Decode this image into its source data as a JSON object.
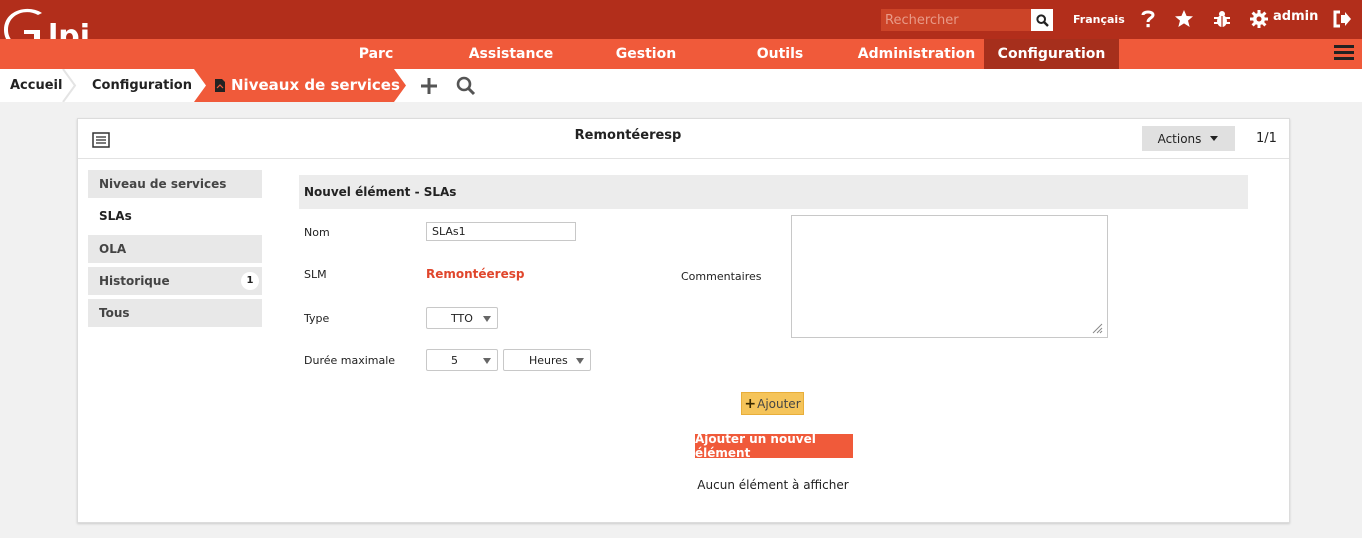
{
  "colors": {
    "topbar": "#b22e1b",
    "menubar": "#f05a3a",
    "menu_active": "#a62f1c",
    "accent": "#f05a3a",
    "ajouter_button": "#f5c45a"
  },
  "header": {
    "logo_text": "Glpi",
    "search_placeholder": "Rechercher",
    "language": "Français",
    "user": "admin",
    "icons": [
      "help-icon",
      "star-icon",
      "bug-icon",
      "gear-icon",
      "logout-icon"
    ]
  },
  "menu": {
    "items": [
      "Parc",
      "Assistance",
      "Gestion",
      "Outils",
      "Administration",
      "Configuration"
    ],
    "active": "Configuration"
  },
  "breadcrumb": {
    "items": [
      "Accueil",
      "Configuration"
    ],
    "active": "Niveaux de services",
    "tools": [
      "add-icon",
      "search-icon"
    ]
  },
  "panel": {
    "title": "Remontéeresp",
    "actions_label": "Actions",
    "pager": "1/1"
  },
  "tabs": [
    {
      "label": "Niveau de services"
    },
    {
      "label": "SLAs",
      "active": true
    },
    {
      "label": "OLA"
    },
    {
      "label": "Historique",
      "badge": "1"
    },
    {
      "label": "Tous"
    }
  ],
  "form": {
    "heading": "Nouvel élément - SLAs",
    "nom_label": "Nom",
    "nom_value": "SLAs1",
    "slm_label": "SLM",
    "slm_value": "Remontéeresp",
    "commentaires_label": "Commentaires",
    "type_label": "Type",
    "type_value": "TTO",
    "duree_label": "Durée maximale",
    "duree_value": "5",
    "duree_unit": "Heures",
    "ajouter_label": "Ajouter",
    "new_element_label": "Ajouter un nouvel élément",
    "empty_message": "Aucun élément à afficher"
  }
}
